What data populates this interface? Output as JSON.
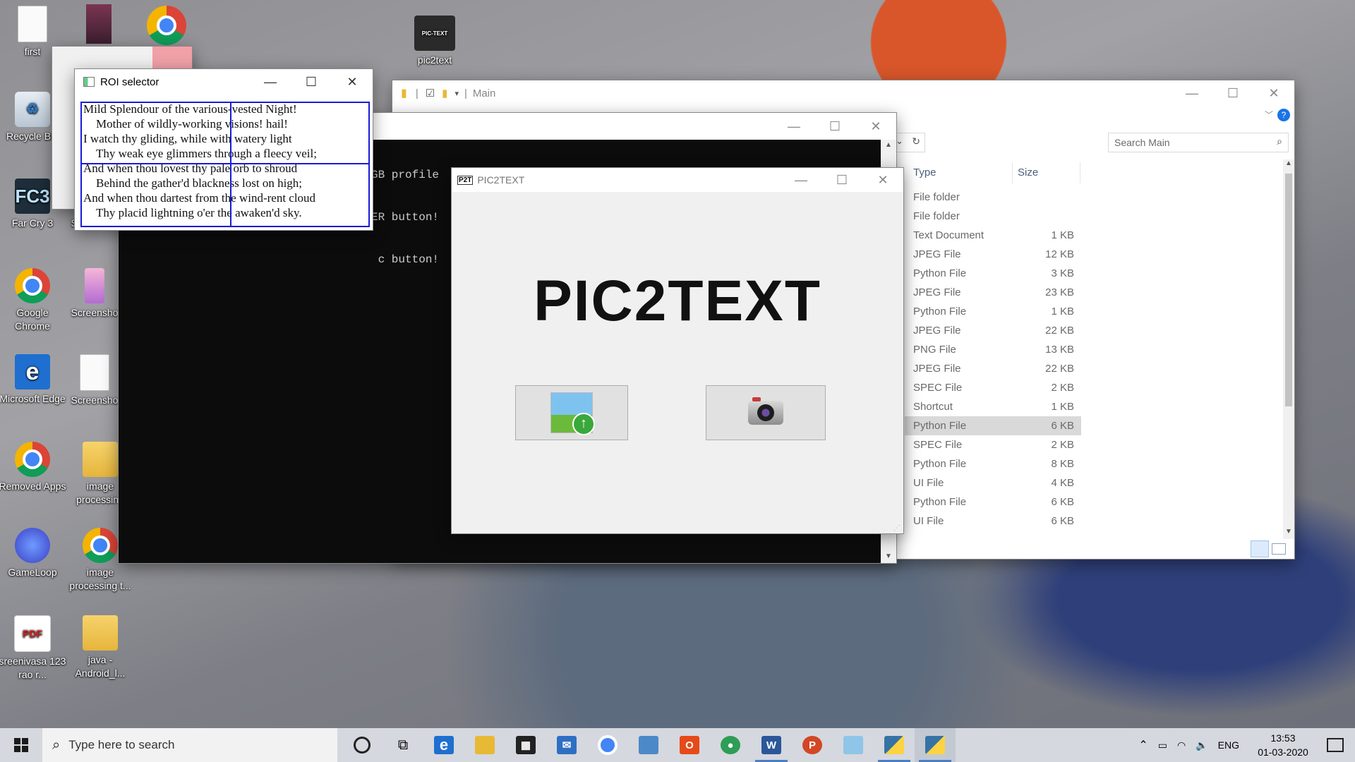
{
  "desktop": {
    "icons": [
      {
        "label": "first",
        "icon": "text-document-icon"
      },
      {
        "label": "Recycle Bin",
        "icon": "recycle-bin-icon"
      },
      {
        "label": "Far Cry 3",
        "icon": "far-cry-3-icon",
        "glyph": "FC3"
      },
      {
        "label": "Screensho",
        "icon": "screenshot-icon"
      },
      {
        "label": "Google Chrome",
        "icon": "chrome-icon"
      },
      {
        "label": "Screensho",
        "icon": "screenshot-icon"
      },
      {
        "label": "Microsoft Edge",
        "icon": "edge-icon",
        "glyph": "e"
      },
      {
        "label": "Screensho",
        "icon": "screenshot-icon"
      },
      {
        "label": "Removed Apps",
        "icon": "chrome-icon"
      },
      {
        "label": "image processing",
        "icon": "folder-icon"
      },
      {
        "label": "GameLoop",
        "icon": "gameloop-icon"
      },
      {
        "label": "image processing t...",
        "icon": "chrome-icon"
      },
      {
        "label": "sreenivasa 123 rao r...",
        "icon": "pdf-icon",
        "glyph": "PDF"
      },
      {
        "label": "java - Android_l...",
        "icon": "folder-icon"
      },
      {
        "label": "pic2text",
        "icon": "pic2text-ppt-icon",
        "glyph": "PIC-TEXT"
      }
    ]
  },
  "roi_window": {
    "title": "ROI selector",
    "lines": [
      "Mild Splendour of the various-vested Night!",
      "Mother of wildly-working visions! hail!",
      "I watch thy gliding, while with watery light",
      "Thy weak eye glimmers through a fleecy veil;",
      "And when thou lovest thy pale orb to shroud",
      "Behind the gather'd blackness lost on high;",
      "And when thou dartest from the wind-rent cloud",
      "Thy placid lightning o'er the awaken'd sky."
    ],
    "roi_color": "#1a1ad8"
  },
  "explorer": {
    "title": "Main",
    "search_placeholder": "Search Main",
    "col_type": "Type",
    "col_size": "Size",
    "rows": [
      {
        "type": "File folder",
        "size": ""
      },
      {
        "type": "File folder",
        "size": ""
      },
      {
        "type": "Text Document",
        "size": "1 KB"
      },
      {
        "type": "JPEG File",
        "size": "12 KB"
      },
      {
        "type": "Python File",
        "size": "3 KB"
      },
      {
        "type": "JPEG File",
        "size": "23 KB"
      },
      {
        "type": "Python File",
        "size": "1 KB"
      },
      {
        "type": "JPEG File",
        "size": "22 KB"
      },
      {
        "type": "PNG File",
        "size": "13 KB"
      },
      {
        "type": "JPEG File",
        "size": "22 KB"
      },
      {
        "type": "SPEC File",
        "size": "2 KB"
      },
      {
        "type": "Shortcut",
        "size": "1 KB"
      },
      {
        "type": "Python File",
        "size": "6 KB",
        "selected": true
      },
      {
        "type": "SPEC File",
        "size": "2 KB"
      },
      {
        "type": "Python File",
        "size": "8 KB"
      },
      {
        "type": "UI File",
        "size": "4 KB"
      },
      {
        "type": "Python File",
        "size": "6 KB"
      },
      {
        "type": "UI File",
        "size": "6 KB"
      }
    ]
  },
  "console": {
    "lines": [
      "GB profile",
      "ER button!",
      " c button!"
    ]
  },
  "pic2text_window": {
    "title": "PIC2TEXT",
    "app_icon_text": "P2T",
    "heading": "PIC2TEXT",
    "upload_button_icon": "upload-image-icon",
    "camera_button_icon": "camera-icon"
  },
  "taskbar": {
    "search_placeholder": "Type here to search",
    "language": "ENG",
    "time": "13:53",
    "date": "01-03-2020"
  }
}
